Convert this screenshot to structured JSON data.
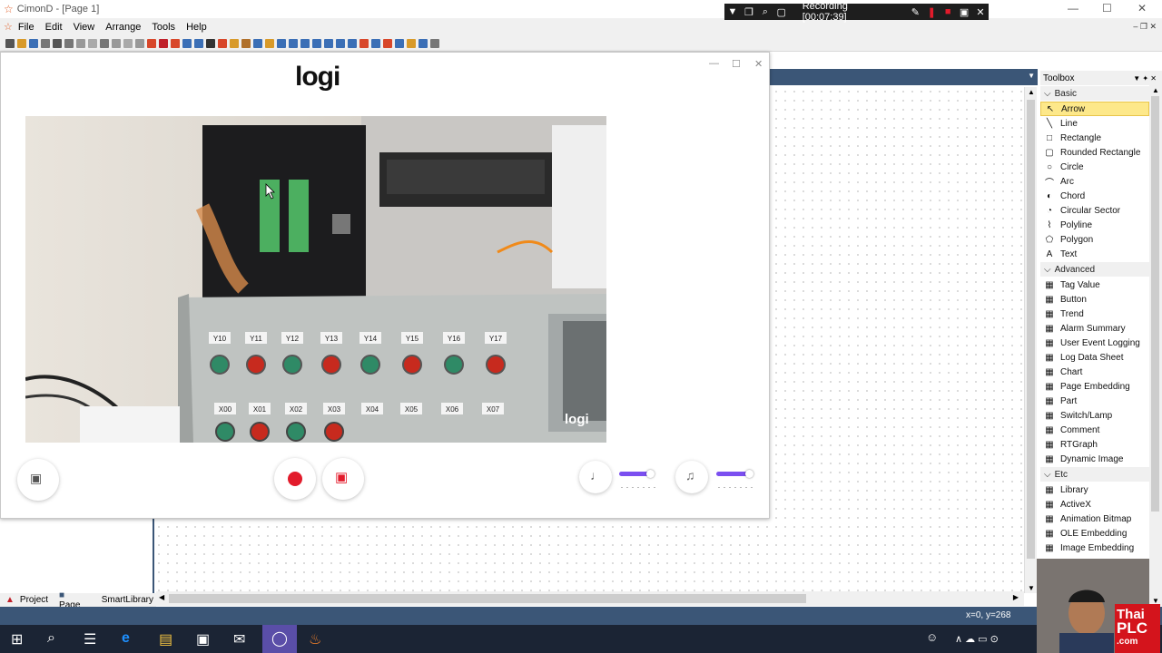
{
  "window": {
    "title": "CimonD - [Page 1]",
    "minimize": "—",
    "maximize": "☐",
    "close": "✕"
  },
  "menu": [
    "File",
    "Edit",
    "View",
    "Arrange",
    "Tools",
    "Help"
  ],
  "recording": {
    "label": "Recording [00:07:39]"
  },
  "logi_window": {
    "brand": "logi",
    "watermark": "logi"
  },
  "video": {
    "y_labels": [
      "Y10",
      "Y11",
      "Y12",
      "Y13",
      "Y14",
      "Y15",
      "Y16",
      "Y17"
    ],
    "x_labels": [
      "X00",
      "X01",
      "X02",
      "X03",
      "X04",
      "X05",
      "X06",
      "X07"
    ]
  },
  "audio": {
    "mic_level": 0.8,
    "speaker_level": 0.85
  },
  "toolbox": {
    "title": "Toolbox",
    "sections": [
      {
        "name": "Basic",
        "items": [
          "Arrow",
          "Line",
          "Rectangle",
          "Rounded Rectangle",
          "Circle",
          "Arc",
          "Chord",
          "Circular Sector",
          "Polyline",
          "Polygon",
          "Text"
        ]
      },
      {
        "name": "Advanced",
        "items": [
          "Tag Value",
          "Button",
          "Trend",
          "Alarm Summary",
          "User Event Logging",
          "Log Data Sheet",
          "Chart",
          "Page Embedding",
          "Part",
          "Switch/Lamp",
          "Comment",
          "RTGraph",
          "Dynamic Image"
        ]
      },
      {
        "name": "Etc",
        "items": [
          "Library",
          "ActiveX",
          "Animation Bitmap",
          "OLE Embedding",
          "Image Embedding"
        ]
      }
    ],
    "selected": "Arrow"
  },
  "left_tabs": {
    "project": "Project",
    "page": "Page",
    "smartlibrary": "SmartLibrary"
  },
  "status": {
    "coords": "x=0, y=268"
  },
  "brand_corner": {
    "line1": "Thai",
    "line2": "PLC",
    "line3": ".com"
  },
  "colors": {
    "accent": "#7b4ff0",
    "record": "#e21b2b",
    "statusbar": "#3b5677"
  }
}
